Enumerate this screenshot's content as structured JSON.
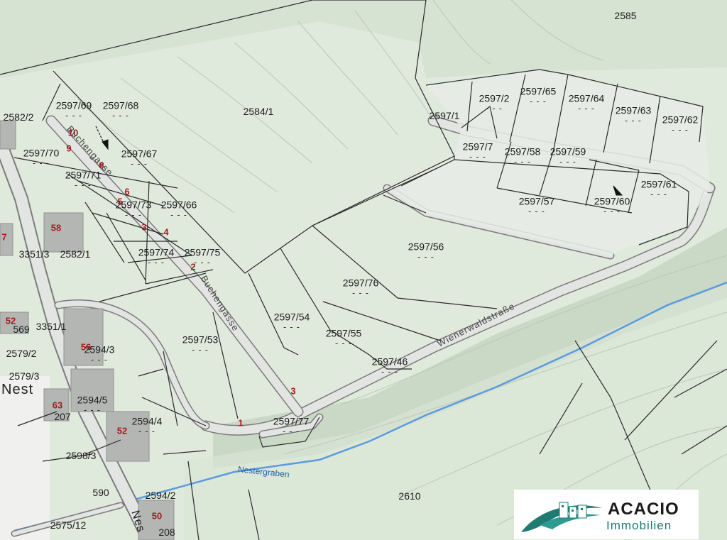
{
  "map": {
    "parcels": [
      {
        "id": "2585",
        "dash": false
      },
      {
        "id": "2584/1",
        "dash": false
      },
      {
        "id": "2582/2",
        "dash": false
      },
      {
        "id": "2597/69",
        "dash": true
      },
      {
        "id": "2597/68",
        "dash": true
      },
      {
        "id": "2597/70",
        "dash": true
      },
      {
        "id": "2597/67",
        "dash": true
      },
      {
        "id": "2597/71",
        "dash": true
      },
      {
        "id": "2597/73",
        "dash": true
      },
      {
        "id": "2597/66",
        "dash": true
      },
      {
        "id": "2597/74",
        "dash": true
      },
      {
        "id": "2597/75",
        "dash": true
      },
      {
        "id": "3351/3",
        "dash": false
      },
      {
        "id": "2582/1",
        "dash": false
      },
      {
        "id": "3351/1",
        "dash": false
      },
      {
        "id": "569",
        "dash": false
      },
      {
        "id": "2579/2",
        "dash": false
      },
      {
        "id": "2579/3",
        "dash": false
      },
      {
        "id": "2594/3",
        "dash": true
      },
      {
        "id": "2594/5",
        "dash": true
      },
      {
        "id": "2594/4",
        "dash": true
      },
      {
        "id": "207",
        "dash": false
      },
      {
        "id": "2598/3",
        "dash": false
      },
      {
        "id": "590",
        "dash": false
      },
      {
        "id": "2594/2",
        "dash": false
      },
      {
        "id": "2575/12",
        "dash": false
      },
      {
        "id": "208",
        "dash": false
      },
      {
        "id": "2597/53",
        "dash": true
      },
      {
        "id": "2597/54",
        "dash": true
      },
      {
        "id": "2597/55",
        "dash": true
      },
      {
        "id": "2597/76",
        "dash": true
      },
      {
        "id": "2597/56",
        "dash": true
      },
      {
        "id": "2597/46",
        "dash": true
      },
      {
        "id": "2597/77",
        "dash": true
      },
      {
        "id": "2597/1",
        "dash": false
      },
      {
        "id": "2597/2",
        "dash": true
      },
      {
        "id": "2597/65",
        "dash": true
      },
      {
        "id": "2597/64",
        "dash": true
      },
      {
        "id": "2597/63",
        "dash": true
      },
      {
        "id": "2597/62",
        "dash": true
      },
      {
        "id": "2597/7",
        "dash": true
      },
      {
        "id": "2597/58",
        "dash": true
      },
      {
        "id": "2597/59",
        "dash": true
      },
      {
        "id": "2597/61",
        "dash": true
      },
      {
        "id": "2597/57",
        "dash": true
      },
      {
        "id": "2597/60",
        "dash": true
      },
      {
        "id": "2610",
        "dash": false
      }
    ],
    "dash_text": "- - -",
    "house_numbers": [
      "10",
      "9",
      "8",
      "6",
      "5",
      "3",
      "4",
      "2",
      "58",
      "7",
      "52",
      "56",
      "63",
      "52",
      "50",
      "3",
      "1"
    ],
    "streets": {
      "buchengasse_upper": "Buchengasse",
      "buchengasse_lower": "Buchengasse",
      "wienerwaldstrasse": "Wienerwaldstraße"
    },
    "place_name": "Nest",
    "place_name_lower": "Nes",
    "stream_name": "Nestergraben"
  },
  "logo": {
    "name": "ACACIO",
    "tagline": "Immobilien"
  },
  "colors": {
    "background": "#dfe9dc",
    "road": "#e3e5e2",
    "road_edge": "#7b7b7b",
    "parcel_line": "#2b2b2b",
    "house_number": "#a51c1c",
    "stream": "#5a9be0",
    "logo_teal": "#1f7a72"
  }
}
